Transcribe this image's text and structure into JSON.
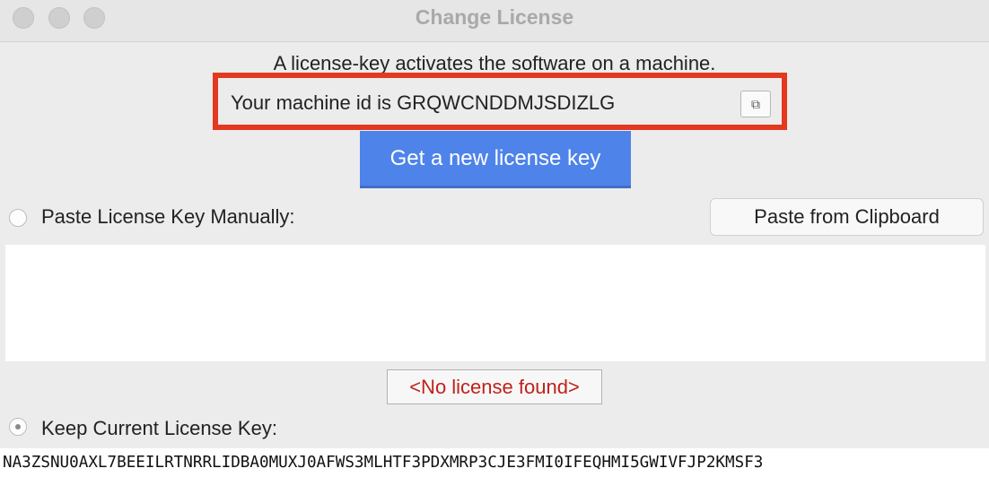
{
  "window": {
    "title": "Change License"
  },
  "info": {
    "text": "A license-key activates the software on a machine."
  },
  "machine": {
    "id_text": "Your machine id is GRQWCNDDMJSDIZLG",
    "copy_icon": "copy-icon",
    "copy_glyph": "⧉"
  },
  "actions": {
    "get_key_label": "Get a new license key"
  },
  "manual": {
    "label": "Paste License Key Manually:",
    "paste_label": "Paste from Clipboard",
    "textarea_value": ""
  },
  "status": {
    "text": "<No license found>"
  },
  "current": {
    "label": "Keep Current License Key:",
    "key": "NA3ZSNU0AXL7BEEILRTNRRLIDBA0MUXJ0AFWS3MLHTF3PDXMRP3CJE3FMI0IFEQHMI5GWIVFJP2KMSF3"
  },
  "colors": {
    "accent": "#4e83ea",
    "highlight_border": "#e2391f",
    "error_text": "#c0211a"
  }
}
